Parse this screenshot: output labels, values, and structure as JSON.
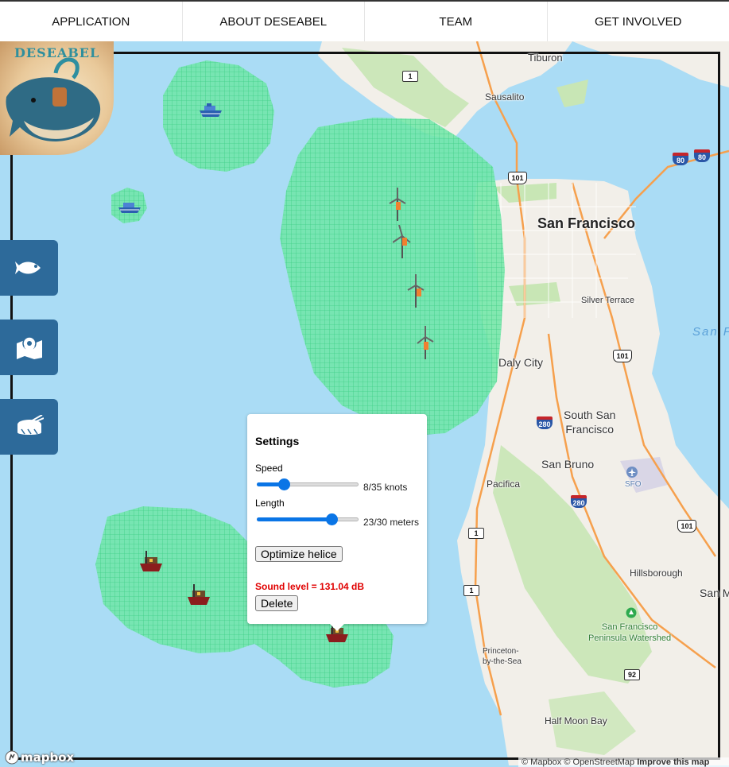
{
  "nav": {
    "items": [
      {
        "label": "APPLICATION"
      },
      {
        "label": "ABOUT DESEABEL"
      },
      {
        "label": "TEAM"
      },
      {
        "label": "GET INVOLVED"
      }
    ]
  },
  "logo": {
    "text": "DESEABEL"
  },
  "sidebar": {
    "buttons": [
      {
        "icon": "fish-icon"
      },
      {
        "icon": "map-marker-icon"
      },
      {
        "icon": "drum-icon"
      }
    ]
  },
  "map": {
    "places": {
      "san_francisco": "San Francisco",
      "tiburon": "Tiburon",
      "sausalito": "Sausalito",
      "silver_terrace": "Silver Terrace",
      "daly_city": "Daly City",
      "south_san_francisco": "South San\nFrancisco",
      "san_bruno": "San Bruno",
      "pacifica": "Pacifica",
      "sfo": "SFO",
      "hillsborough": "Hillsborough",
      "san_m": "San M",
      "watershed": "San Francisco\nPeninsula Watershed",
      "princeton": "Princeton-\nby-the-Sea",
      "half_moon_bay": "Half Moon Bay",
      "bay_label": "San Fr"
    },
    "shields": {
      "r1a": "1",
      "r101a": "101",
      "r80a": "80",
      "r80b": "80",
      "r101b": "101",
      "r280a": "280",
      "r280b": "280",
      "r1b": "1",
      "r1c": "1",
      "r101c": "101",
      "r92": "92"
    },
    "colors": {
      "water": "#aadcf5",
      "land": "#f2efe9",
      "park": "#c8e6b5",
      "noise_zone": "#6ee7a6",
      "highway": "#f6a04d",
      "frame": "#111111"
    },
    "markers": {
      "ships": [
        "cruise-ship-icon",
        "cruise-ship-icon"
      ],
      "turbines": [
        "wind-turbine-icon",
        "wind-turbine-icon",
        "wind-turbine-icon",
        "wind-turbine-icon"
      ],
      "boats": [
        "cargo-boat-icon",
        "cargo-boat-icon",
        "cargo-boat-icon"
      ]
    }
  },
  "settings_popup": {
    "title": "Settings",
    "speed": {
      "label": "Speed",
      "value": 8,
      "max": 35,
      "display": "8/35 knots"
    },
    "length": {
      "label": "Length",
      "value": 23,
      "max": 30,
      "display": "23/30 meters"
    },
    "optimize_label": "Optimize helice",
    "sound_level": "Sound level = 131.04 dB",
    "delete_label": "Delete"
  },
  "attribution": {
    "mapbox_logo": "mapbox",
    "text": "© Mapbox © OpenStreetMap",
    "improve": "Improve this map"
  }
}
